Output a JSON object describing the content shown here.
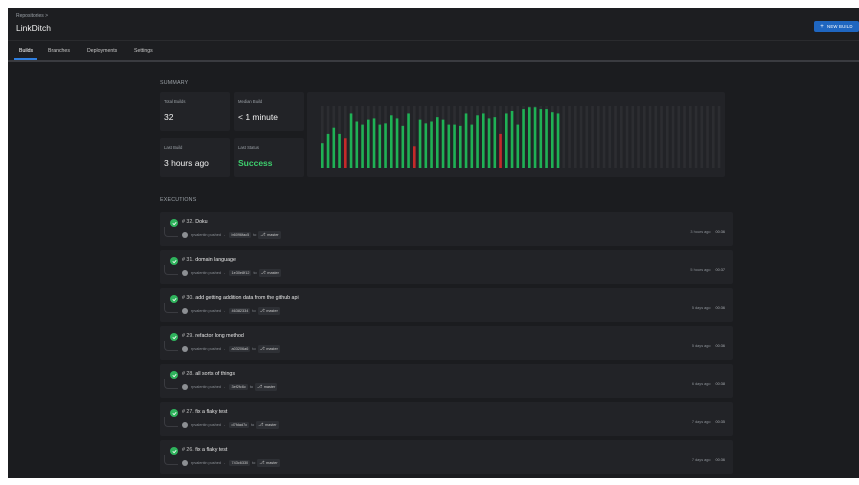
{
  "header": {
    "breadcrumb": "Repositories  >",
    "repo_name": "LinkDitch",
    "new_build_label": "NEW BUILD",
    "new_build_icon": "plus-icon"
  },
  "tabs": [
    {
      "label": "Builds",
      "active": true
    },
    {
      "label": "Branches",
      "active": false
    },
    {
      "label": "Deployments",
      "active": false
    },
    {
      "label": "Settings",
      "active": false
    }
  ],
  "summary": {
    "section_label": "SUMMARY",
    "total_builds_label": "Total Builds",
    "total_builds_value": "32",
    "median_build_label": "Median Build",
    "median_build_value": "< 1 minute",
    "last_build_label": "Last Build",
    "last_build_value": "3 hours ago",
    "last_status_label": "Last Status",
    "last_status_value": "Success"
  },
  "chart_data": {
    "type": "bar",
    "statuses": [
      "success",
      "success",
      "success",
      "success",
      "failure",
      "success",
      "success",
      "success",
      "success",
      "success",
      "success",
      "success",
      "success",
      "success",
      "success",
      "success",
      "failure",
      "success",
      "success",
      "success",
      "success",
      "success",
      "success",
      "success",
      "success",
      "success",
      "success",
      "success",
      "success",
      "success",
      "success",
      "failure",
      "success",
      "success",
      "success",
      "success",
      "success",
      "success",
      "success",
      "success",
      "success",
      "success",
      "success",
      "success",
      "success"
    ],
    "values": [
      0.4,
      0.55,
      0.65,
      0.55,
      0.48,
      0.88,
      0.75,
      0.7,
      0.78,
      0.8,
      0.7,
      0.72,
      0.85,
      0.8,
      0.68,
      0.88,
      0.35,
      0.78,
      0.72,
      0.75,
      0.82,
      0.78,
      0.7,
      0.7,
      0.68,
      0.88,
      0.7,
      0.85,
      0.88,
      0.8,
      0.82,
      0.55,
      0.88,
      0.92,
      0.7,
      0.95,
      0.98,
      0.98,
      0.95,
      0.95,
      0.9,
      0.88,
      0.0,
      0.0,
      0.0
    ],
    "total_slots": 70,
    "colors": {
      "success": "#1fb155",
      "failure": "#c52a2a",
      "empty": "#2c2d31"
    }
  },
  "executions_label": "EXECUTIONS",
  "executions": [
    {
      "number": "# 32.",
      "title": "Doku",
      "user": "rpvalentin pushed",
      "commit": "b6096fac5",
      "to": "to",
      "branch": "master",
      "when": "3 hours ago",
      "duration": "00:36"
    },
    {
      "number": "# 31.",
      "title": "domain language",
      "user": "rpvalentin pushed",
      "commit": "1e30e8f12",
      "to": "to",
      "branch": "master",
      "when": "5 hours ago",
      "duration": "00:37"
    },
    {
      "number": "# 30.",
      "title": "add getting addition data from the github api",
      "user": "rpvalentin pushed",
      "commit": "46382334",
      "to": "to",
      "branch": "master",
      "when": "5 days ago",
      "duration": "00:36"
    },
    {
      "number": "# 29.",
      "title": "refactor long method",
      "user": "rpvalentin pushed",
      "commit": "a03206a6",
      "to": "to",
      "branch": "master",
      "when": "5 days ago",
      "duration": "00:36"
    },
    {
      "number": "# 28.",
      "title": "all sorts of things",
      "user": "rpvalentin pushed",
      "commit": "3ef2fc6c",
      "to": "to",
      "branch": "master",
      "when": "6 days ago",
      "duration": "00:38"
    },
    {
      "number": "# 27.",
      "title": "fix a flaky test",
      "user": "rpvalentin pushed",
      "commit": "d7fdad7c",
      "to": "to",
      "branch": "master",
      "when": "7 days ago",
      "duration": "00:35"
    },
    {
      "number": "# 26.",
      "title": "fix a flaky test",
      "user": "rpvalentin pushed",
      "commit": "743c6330",
      "to": "to",
      "branch": "master",
      "when": "7 days ago",
      "duration": "00:36"
    }
  ]
}
